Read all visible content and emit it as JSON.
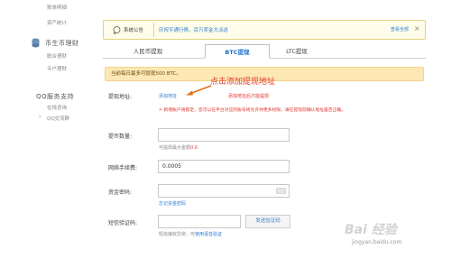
{
  "sidebar": {
    "top_items": [
      "账单明细",
      "资产统计"
    ],
    "section_title": "币生币理财",
    "section_items": [
      "联合理财",
      "专户理财"
    ],
    "qq_title": "QQ服务支持",
    "qq_items": [
      "在线咨询",
      "QQ交流群"
    ]
  },
  "notice": {
    "label": "系统公告",
    "message": "庆祝平通行情，百万奖金大派送",
    "view_all": "查看全部",
    "close": "×"
  },
  "tabs": [
    "人民币提现",
    "BTC提现",
    "LTC提现"
  ],
  "active_tab": "BTC提现",
  "limit_text": "当前每日最多可提现500 BTC。",
  "form": {
    "address_label": "提现地址:",
    "add_address_link": "添加地址",
    "address_select_link": "添加地址后才能提现",
    "warning_text": "> 新增账户将锁定，您可以在平台对应的账号将允许你更多权限，请在提现前确认地址是否正确。",
    "amount_label": "提币数量:",
    "amount_value": "",
    "amount_hint": "可提现最大金额",
    "amount_hint_value": "0.0",
    "fee_label": "网络手续费:",
    "fee_value": "0.0005",
    "password_label": "资金密码:",
    "password_value": "",
    "forgot_password": "忘记资金密码",
    "sms_label": "短信验证码:",
    "sms_value": "",
    "send_code_button": "发送验证码",
    "sms_hint": "短信接收异常，可",
    "voice_link": "使用语音验证"
  },
  "annotation": "点击添加提现地址",
  "watermark": {
    "logo": "Bai 经验",
    "url": "jingyan.baidu.com"
  },
  "colors": {
    "accent_blue": "#2f7fd3",
    "warning_red": "#e0322d",
    "annotation_orange": "#e8701a"
  }
}
